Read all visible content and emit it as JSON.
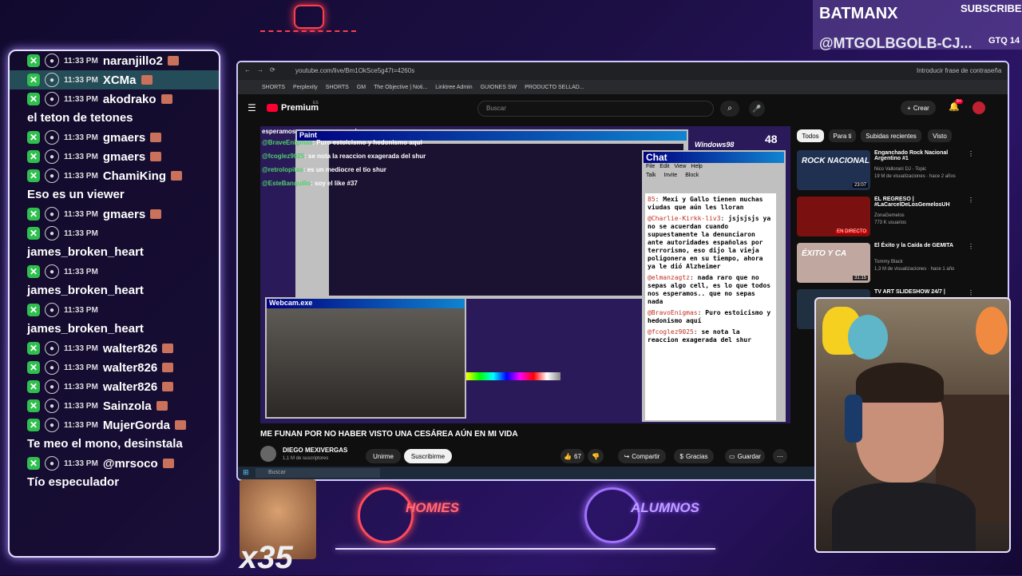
{
  "overlay": {
    "top_right_name": "BATMANX",
    "top_right_label": "SUBSCRIBER",
    "top_right_handle": "@MTGOLBGOLB-CJ...",
    "top_right_tag": "GTQ 14",
    "combo_count": "x35",
    "logo_homies": "HOMIES",
    "logo_alumnos": "ALUMNOS"
  },
  "chat": [
    {
      "type": "row",
      "time": "11:33 PM",
      "user": "naranjillo2"
    },
    {
      "type": "row",
      "time": "11:33 PM",
      "user": "XCMa",
      "highlight": true
    },
    {
      "type": "row",
      "time": "11:33 PM",
      "user": "akodrako"
    },
    {
      "type": "msg",
      "text": "el teton de tetones"
    },
    {
      "type": "row",
      "time": "11:33 PM",
      "user": "gmaers"
    },
    {
      "type": "row",
      "time": "11:33 PM",
      "user": "gmaers"
    },
    {
      "type": "row",
      "time": "11:33 PM",
      "user": "ChamiKing"
    },
    {
      "type": "msg",
      "text": "Eso es un viewer"
    },
    {
      "type": "row",
      "time": "11:33 PM",
      "user": "gmaers"
    },
    {
      "type": "row",
      "time": "11:33 PM",
      "user": ""
    },
    {
      "type": "msg",
      "text": "james_broken_heart"
    },
    {
      "type": "row",
      "time": "11:33 PM",
      "user": ""
    },
    {
      "type": "msg",
      "text": "james_broken_heart"
    },
    {
      "type": "row",
      "time": "11:33 PM",
      "user": ""
    },
    {
      "type": "msg",
      "text": "james_broken_heart"
    },
    {
      "type": "row",
      "time": "11:33 PM",
      "user": "walter826"
    },
    {
      "type": "row",
      "time": "11:33 PM",
      "user": "walter826"
    },
    {
      "type": "row",
      "time": "11:33 PM",
      "user": "walter826"
    },
    {
      "type": "row",
      "time": "11:33 PM",
      "user": "Sainzola"
    },
    {
      "type": "row",
      "time": "11:33 PM",
      "user": "MujerGorda"
    },
    {
      "type": "msg",
      "text": "Te meo el mono, desinstala"
    },
    {
      "type": "row",
      "time": "11:33 PM",
      "user": "@mrsoco"
    },
    {
      "type": "msg",
      "text": "Tío especulador"
    }
  ],
  "browser": {
    "url": "youtube.com/live/Bm1OkSce5g47t=4260s",
    "password_hint": "Introducir frase de contraseña",
    "bookmarks": [
      "SHORTS",
      "Perplexity",
      "SHORTS",
      "GM",
      "The Objective | Noti...",
      "Linktree Admin",
      "GUIONES SW",
      "PRODUCTO SELLAD..."
    ],
    "brand": "Premium",
    "brand_region": "ES",
    "search_placeholder": "Buscar",
    "create_label": "Crear",
    "notif_count": "9+"
  },
  "video": {
    "overlay_line": "esperamos... que no sepas nada",
    "paint_title": "Paint",
    "webcam_title": "Webcam.exe",
    "chat_title": "Chat",
    "chat_menu": [
      "File",
      "Edit",
      "View",
      "Help"
    ],
    "chat_actions": [
      "Talk",
      "Invite",
      "Block"
    ],
    "viewer_count": "48",
    "os_label": "Windows98",
    "stream_chat": [
      {
        "user": "@BraveEnigmas",
        "text": ": Puro estoicismo y hedonismo aqui"
      },
      {
        "user": "@fcoglez9025",
        "text": ": se nota la reaccion exagerada del shur"
      },
      {
        "user": "@retrolopitas",
        "text": ": es un mediocre el tio shur"
      },
      {
        "user": "@EsteBanquillo",
        "text": ": soy el like #37"
      }
    ],
    "chat_messages": [
      {
        "user": "85",
        "text": "Mexi y Gallo tienen muchas viudas que aún les lloran"
      },
      {
        "user": "@Charlie-Kirkk-liv3",
        "text": "jsjsjsjs ya no se acuerdan cuando supuestamente la denunciaron ante autoridades españolas por terrorismo, eso dijo la vieja poligonera en su tiempo, ahora ya le dió Alzheimer"
      },
      {
        "user": "@elmanzagtz",
        "text": "nada raro que no sepas algo cell, es lo que todos nos esperamos.. que no sepas nada"
      },
      {
        "user": "@BravoEnigmas",
        "text": "Puro estoicismo y hedonismo aquí"
      },
      {
        "user": "@fcoglez9025",
        "text": "se nota la reaccion exagerada del shur"
      }
    ],
    "title": "ME FUNAN POR NO HABER VISTO UNA CESÁREA AÚN EN MI VIDA",
    "channel": "DIEGO MEXIVERGAS",
    "subscribers": "1,1 M de suscriptores",
    "unsubscribe": "Unirme",
    "subscribe": "Suscribirme",
    "likes": "67",
    "share": "Compartir",
    "thanks": "Gracias",
    "save": "Guardar"
  },
  "taskbar": {
    "search": "Buscar"
  },
  "sidebar": {
    "chips": [
      "Todos",
      "Para ti",
      "Subidas recientes",
      "Visto"
    ],
    "items": [
      {
        "title": "Enganchado Rock Nacional Argentino #1",
        "channel": "Nico Valloranì DJ - Topic",
        "meta": "19 M de visualizaciones · hace 2 años",
        "duration": "23:07",
        "thumb_text": "ROCK NACIONAL"
      },
      {
        "title": "EL REGRESO | #LaCarcelDeLosGemelosUH",
        "channel": "ZonaGemelos",
        "meta": "773 K usuarios",
        "duration": "EN DIRECTO",
        "thumb_text": ""
      },
      {
        "title": "El Éxito y la Caída de GEMITA",
        "channel": "Tommy Black",
        "meta": "1,3 M de visualizaciones · hace 1 año",
        "duration": "31:15",
        "thumb_text": "ÉXITO Y CA"
      },
      {
        "title": "TV ART SLIDESHOW 24/7 |",
        "channel": "",
        "meta": "",
        "duration": "",
        "thumb_text": ""
      }
    ]
  },
  "colors": {
    "accent": "#a070ff",
    "yt_red": "#ff0033",
    "chat_green": "#2fbf4e"
  }
}
